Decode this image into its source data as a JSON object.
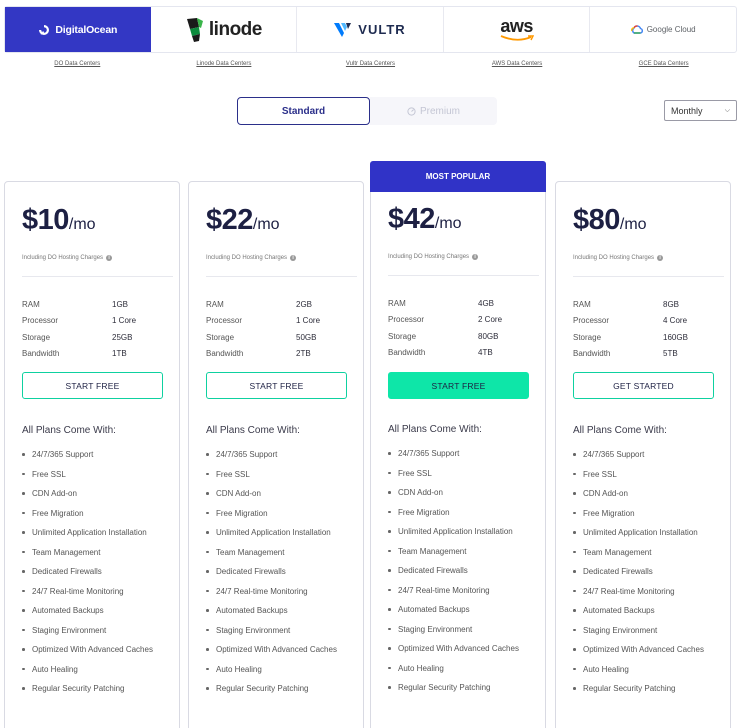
{
  "providers": [
    {
      "name": "DigitalOcean",
      "icon": "digitalocean-icon",
      "dc_link": "DO Data Centers",
      "active": true
    },
    {
      "name": "linode",
      "icon": "linode-icon",
      "dc_link": "Linode Data Centers",
      "active": false
    },
    {
      "name": "VULTR",
      "icon": "vultr-icon",
      "dc_link": "Vultr Data Centers",
      "active": false
    },
    {
      "name": "aws",
      "icon": "aws-icon",
      "dc_link": "AWS Data Centers",
      "active": false
    },
    {
      "name": "Google Cloud",
      "icon": "google-cloud-icon",
      "dc_link": "GCE Data Centers",
      "active": false
    }
  ],
  "toggle": {
    "standard": "Standard",
    "premium": "Premium"
  },
  "billing": {
    "selected": "Monthly"
  },
  "popular_label": "MOST POPULAR",
  "charges_note": "Including DO Hosting Charges",
  "all_plans_label": "All Plans Come With:",
  "spec_labels": {
    "ram": "RAM",
    "processor": "Processor",
    "storage": "Storage",
    "bandwidth": "Bandwidth"
  },
  "plans": [
    {
      "price": "$10",
      "per": "/mo",
      "ram": "1GB",
      "processor": "1 Core",
      "storage": "25GB",
      "bandwidth": "1TB",
      "cta": "START FREE"
    },
    {
      "price": "$22",
      "per": "/mo",
      "ram": "2GB",
      "processor": "1 Core",
      "storage": "50GB",
      "bandwidth": "2TB",
      "cta": "START FREE"
    },
    {
      "price": "$42",
      "per": "/mo",
      "ram": "4GB",
      "processor": "2 Core",
      "storage": "80GB",
      "bandwidth": "4TB",
      "cta": "START FREE"
    },
    {
      "price": "$80",
      "per": "/mo",
      "ram": "8GB",
      "processor": "4 Core",
      "storage": "160GB",
      "bandwidth": "5TB",
      "cta": "GET STARTED"
    }
  ],
  "features": [
    "24/7/365 Support",
    "Free SSL",
    "CDN Add-on",
    "Free Migration",
    "Unlimited Application Installation",
    "Team Management",
    "Dedicated Firewalls",
    "24/7 Real-time Monitoring",
    "Automated Backups",
    "Staging Environment",
    "Optimized With Advanced Caches",
    "Auto Healing",
    "Regular Security Patching"
  ],
  "colors": {
    "brand": "#3337c4",
    "cta_green": "#0ee6a8",
    "price_text": "#1d2043"
  }
}
